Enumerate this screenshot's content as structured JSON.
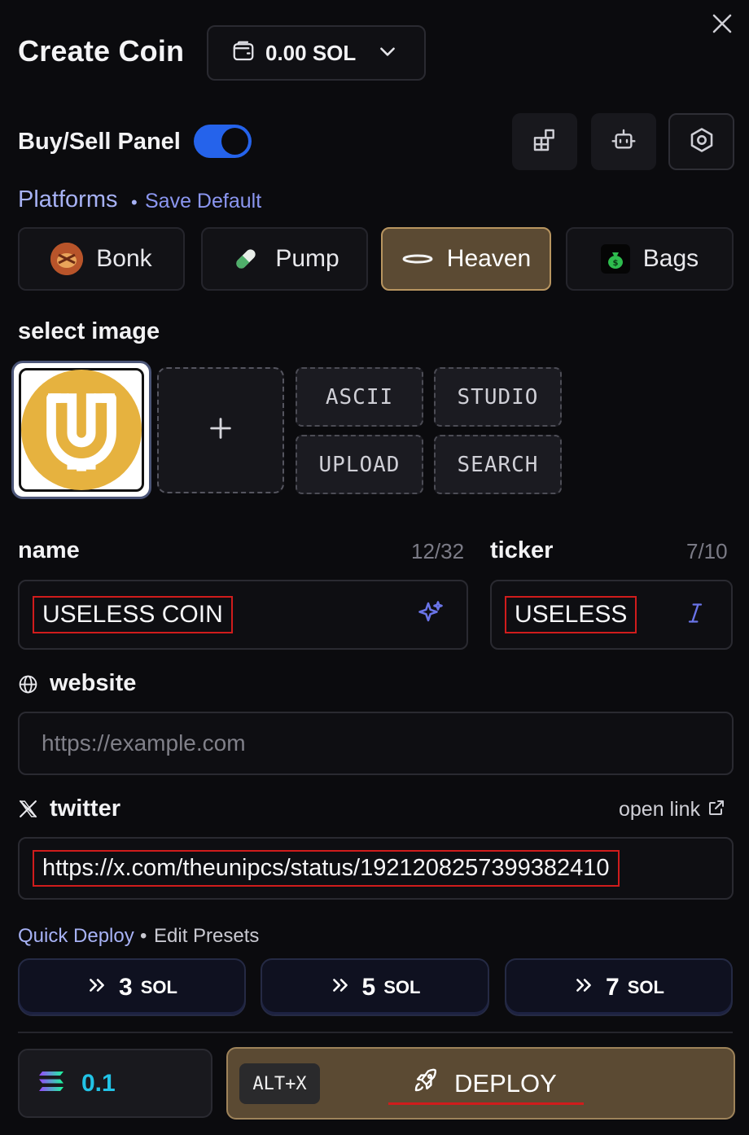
{
  "header": {
    "title": "Create Coin",
    "wallet_balance": "0.00 SOL"
  },
  "buy_sell": {
    "label": "Buy/Sell Panel",
    "enabled": true
  },
  "icons": {
    "wallet": "wallet-icon",
    "dropdown": "chevron-down-icon",
    "close": "close-icon",
    "widgets": "widgets-icon",
    "bot": "bot-icon",
    "settings": "hexagon-settings-icon",
    "sparkle": "sparkle-icon",
    "italic": "italic-icon",
    "globe": "globe-icon",
    "x": "x-logo-icon",
    "external": "external-link-icon",
    "chevrons": "double-chevron-right-icon",
    "solana": "solana-icon",
    "rocket": "rocket-icon",
    "plus": "plus-icon"
  },
  "platforms": {
    "title": "Platforms",
    "separator": "•",
    "save_default": "Save Default",
    "items": [
      {
        "label": "Bonk"
      },
      {
        "label": "Pump"
      },
      {
        "label": "Heaven",
        "active": true
      },
      {
        "label": "Bags"
      }
    ]
  },
  "image": {
    "label": "select image",
    "buttons": [
      "ASCII",
      "STUDIO",
      "UPLOAD",
      "SEARCH"
    ]
  },
  "name": {
    "label": "name",
    "count": "12/32",
    "value": "USELESS COIN"
  },
  "ticker": {
    "label": "ticker",
    "count": "7/10",
    "value": "USELESS"
  },
  "website": {
    "label": "website",
    "placeholder": "https://example.com"
  },
  "twitter": {
    "label": "twitter",
    "open_link": "open link",
    "value": "https://x.com/theunipcs/status/1921208257399382410"
  },
  "quick_deploy": {
    "title": "Quick Deploy",
    "separator": "•",
    "edit": "Edit Presets",
    "presets": [
      {
        "amount": "3",
        "unit": "SOL"
      },
      {
        "amount": "5",
        "unit": "SOL"
      },
      {
        "amount": "7",
        "unit": "SOL"
      }
    ]
  },
  "footer": {
    "amount": "0.1",
    "hotkey": "ALT+X",
    "deploy_label": "DEPLOY"
  },
  "colors": {
    "accent_blue": "#2563eb",
    "platform_active": "#5b4a33",
    "link": "#a7b2f5",
    "solana_value": "#22c3e6",
    "highlight_red": "#d01c1c"
  }
}
